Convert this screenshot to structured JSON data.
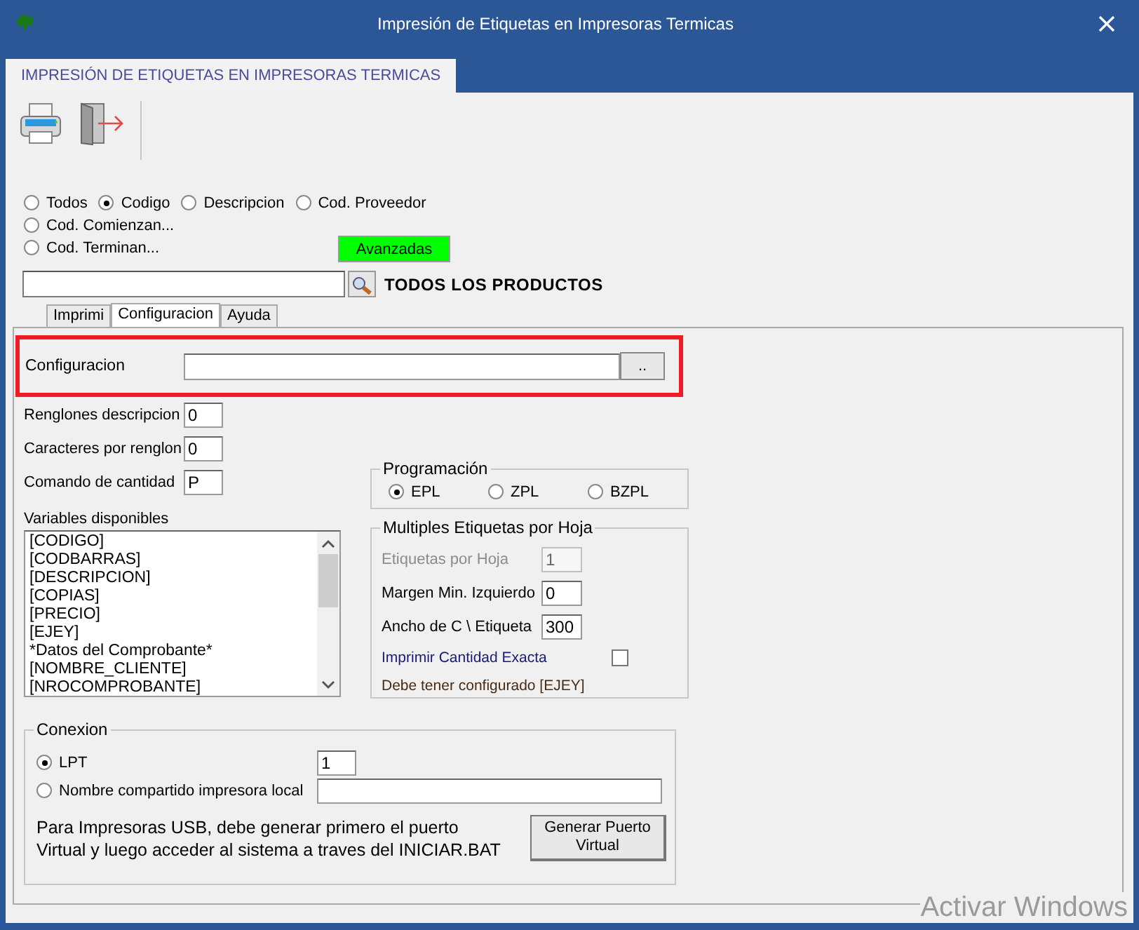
{
  "window": {
    "title": "Impresión de Etiquetas en Impresoras Termicas"
  },
  "main_tab": {
    "label": "IMPRESIÓN DE ETIQUETAS EN IMPRESORAS TERMICAS",
    "selected": true
  },
  "search_filters": [
    {
      "label": "Todos",
      "selected": false
    },
    {
      "label": "Codigo",
      "selected": true
    },
    {
      "label": "Descripcion",
      "selected": false
    },
    {
      "label": "Cod. Proveedor",
      "selected": false
    },
    {
      "label": "Cod. Comienzan...",
      "selected": false
    },
    {
      "label": "Cod. Terminan...",
      "selected": false
    }
  ],
  "advanced_button": "Avanzadas",
  "scope_label": "TODOS LOS PRODUCTOS",
  "tabs": [
    {
      "label": "Imprimi",
      "selected": false
    },
    {
      "label": "Configuracion",
      "selected": true
    },
    {
      "label": "Ayuda",
      "selected": false
    }
  ],
  "config": {
    "label": "Configuracion",
    "browse_button": "..",
    "highlighted": true
  },
  "fields": [
    {
      "label": "Renglones descripcion",
      "value": "0"
    },
    {
      "label": "Caracteres por renglon",
      "value": "0"
    },
    {
      "label": "Comando de cantidad",
      "value": "P"
    }
  ],
  "programacion": {
    "title": "Programación",
    "options": [
      {
        "label": "EPL",
        "selected": true
      },
      {
        "label": "ZPL",
        "selected": false
      },
      {
        "label": "BZPL",
        "selected": false
      }
    ]
  },
  "variables": {
    "label": "Variables disponibles",
    "items": [
      "[CODIGO]",
      "[CODBARRAS]",
      "[DESCRIPCION]",
      "[COPIAS]",
      "[PRECIO]",
      "[EJEY]",
      "*Datos del Comprobante*",
      "[NOMBRE_CLIENTE]",
      "[NROCOMPROBANTE]"
    ]
  },
  "multiples": {
    "title": "Multiples Etiquetas por Hoja",
    "fields": [
      {
        "label": "Etiquetas por Hoja",
        "value": "1",
        "disabled": true
      },
      {
        "label": "Margen Min. Izquierdo",
        "value": "0",
        "disabled": false
      },
      {
        "label": "Ancho de C \\ Etiqueta",
        "value": "300",
        "disabled": false
      }
    ],
    "exact": {
      "label": "Imprimir Cantidad Exacta",
      "checked": false
    },
    "note": "Debe tener configurado [EJEY]"
  },
  "conexion": {
    "title": "Conexion",
    "options": [
      {
        "label": "LPT",
        "selected": true,
        "value": "1"
      },
      {
        "label": "Nombre compartido impresora local",
        "selected": false
      }
    ],
    "note_lines": [
      "Para Impresoras USB, debe generar primero el puerto",
      "Virtual y luego acceder al sistema a traves del INICIAR.BAT"
    ],
    "button": "Generar Puerto Virtual"
  },
  "os_notice": "Activar Windows"
}
